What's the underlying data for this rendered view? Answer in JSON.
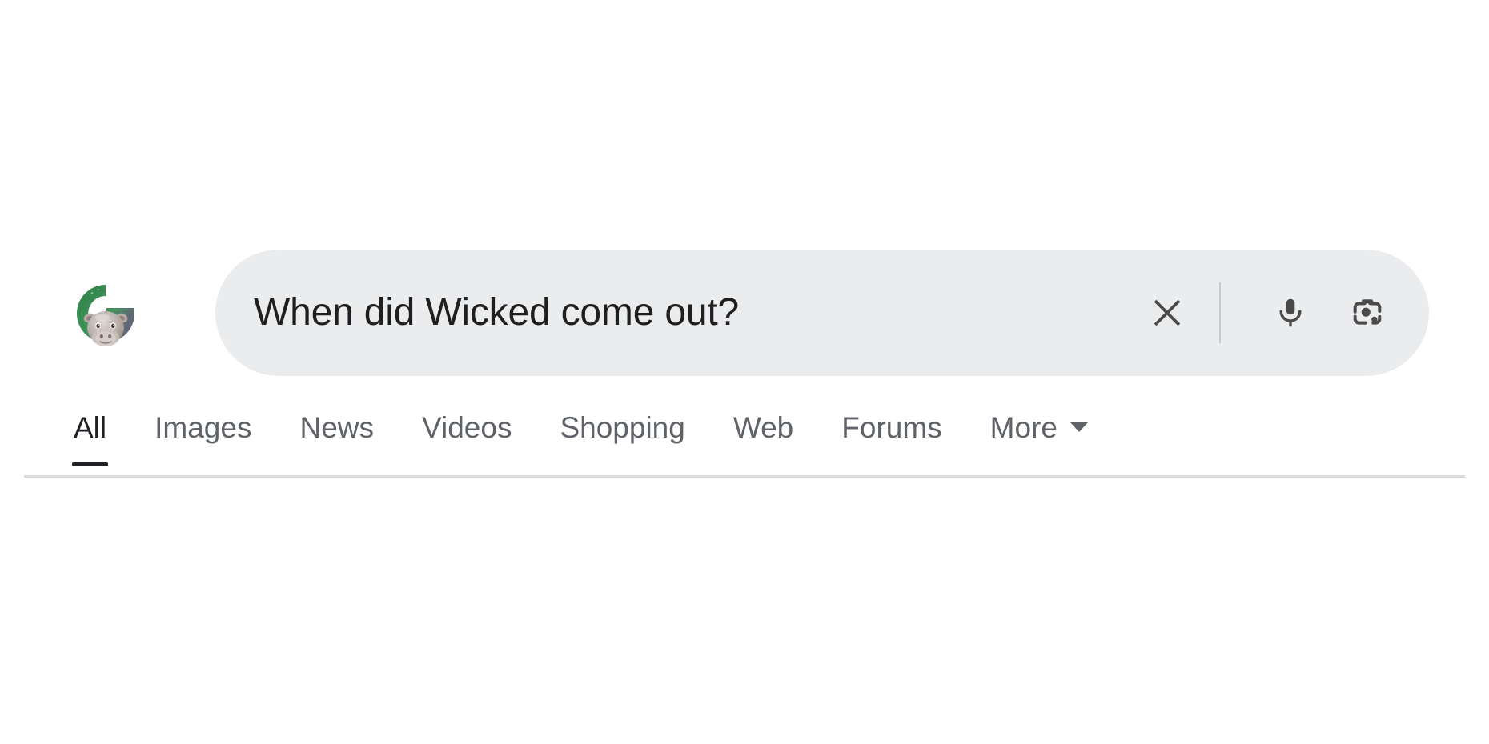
{
  "page": {
    "background_color": "#ffffff"
  },
  "logo": {
    "name": "google-doodle-logo",
    "description": "Google G with hippo doodle",
    "colors": {
      "g_green": "#3a8f52",
      "g_purple": "#655b7d",
      "hippo_body": "#b8aeaa",
      "hippo_light": "#d8d2cd",
      "hippo_dark": "#8a7d78",
      "hippo_eye": "#3b2b22"
    }
  },
  "search": {
    "query": "When did Wicked come out?",
    "placeholder": "Search",
    "bar_color": "#ebecee",
    "text_color": "#1f1f1f",
    "clear_label": "Clear",
    "voice_label": "Search by voice",
    "lens_label": "Search by image",
    "icons": {
      "clear": "close-icon",
      "voice": "microphone-icon",
      "lens": "google-lens-camera-icon"
    },
    "icon_color": "#4a4a4a",
    "divider_color": "#c7c9cc"
  },
  "tabs": {
    "active_index": 0,
    "active_color": "#202124",
    "inactive_color": "#5f6368",
    "items": [
      {
        "label": "All"
      },
      {
        "label": "Images"
      },
      {
        "label": "News"
      },
      {
        "label": "Videos"
      },
      {
        "label": "Shopping"
      },
      {
        "label": "Web"
      },
      {
        "label": "Forums"
      },
      {
        "label": "More",
        "has_caret": true
      }
    ]
  },
  "rule": {
    "color": "#dadce0"
  }
}
